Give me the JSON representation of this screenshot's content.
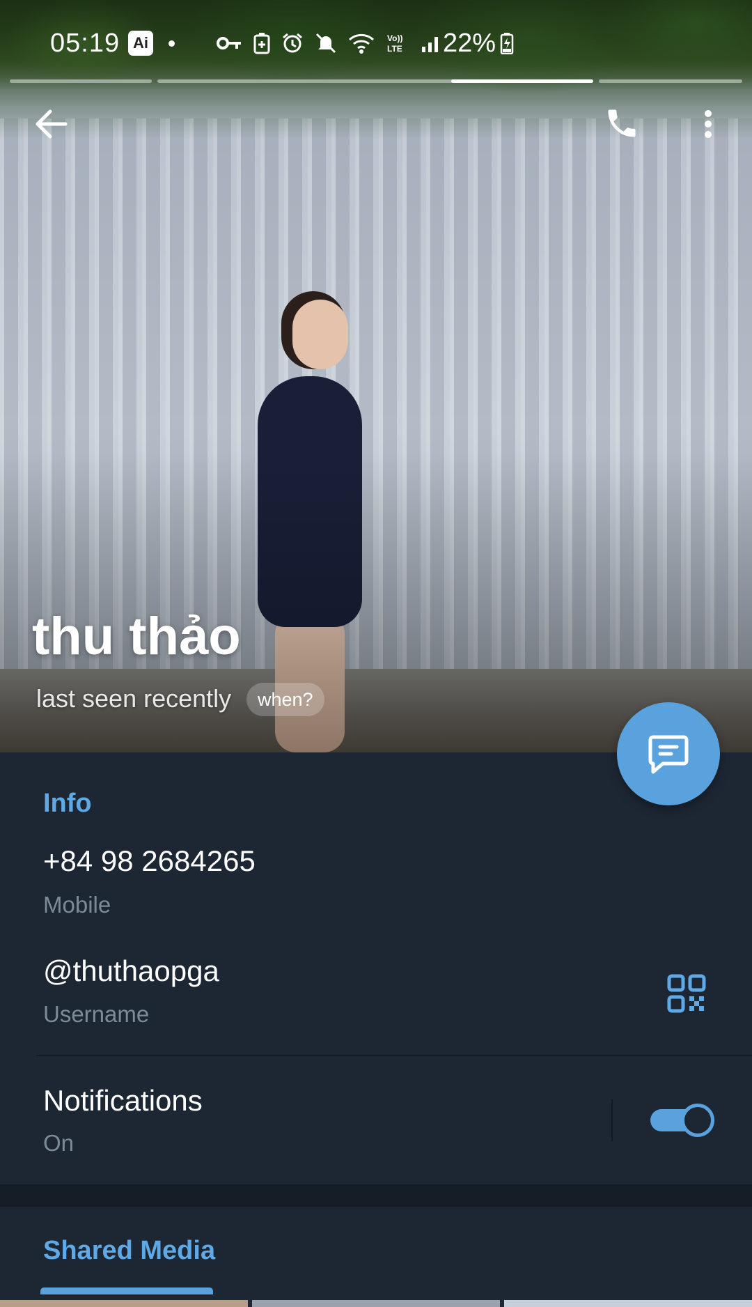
{
  "status_bar": {
    "time": "05:19",
    "ai_badge": "Ai",
    "battery_percent": "22%",
    "icons": [
      "vpn-key-icon",
      "battery-saver-icon",
      "alarm-icon",
      "mute-icon",
      "wifi-icon",
      "volte-icon",
      "signal-icon",
      "charging-icon"
    ]
  },
  "story": {
    "segments": 4,
    "active_index": 3
  },
  "header": {
    "back_icon": "arrow-left-icon",
    "call_icon": "phone-icon",
    "menu_icon": "more-vert-icon"
  },
  "profile": {
    "name": "thu thảo",
    "last_seen": "last seen recently",
    "when_label": "when?"
  },
  "fab": {
    "icon": "message-icon",
    "color": "#5aa2de"
  },
  "info": {
    "title": "Info",
    "phone": {
      "value": "+84 98 2684265",
      "label": "Mobile"
    },
    "username": {
      "value": "@thuthaopga",
      "label": "Username",
      "qr_icon": "qr-code-icon"
    },
    "notifications": {
      "value": "Notifications",
      "label": "On",
      "enabled": true
    }
  },
  "shared_media": {
    "tab_label": "Shared Media"
  },
  "colors": {
    "accent": "#5fa9e6",
    "background": "#1d2733",
    "secondary_text": "#7d8b99"
  }
}
